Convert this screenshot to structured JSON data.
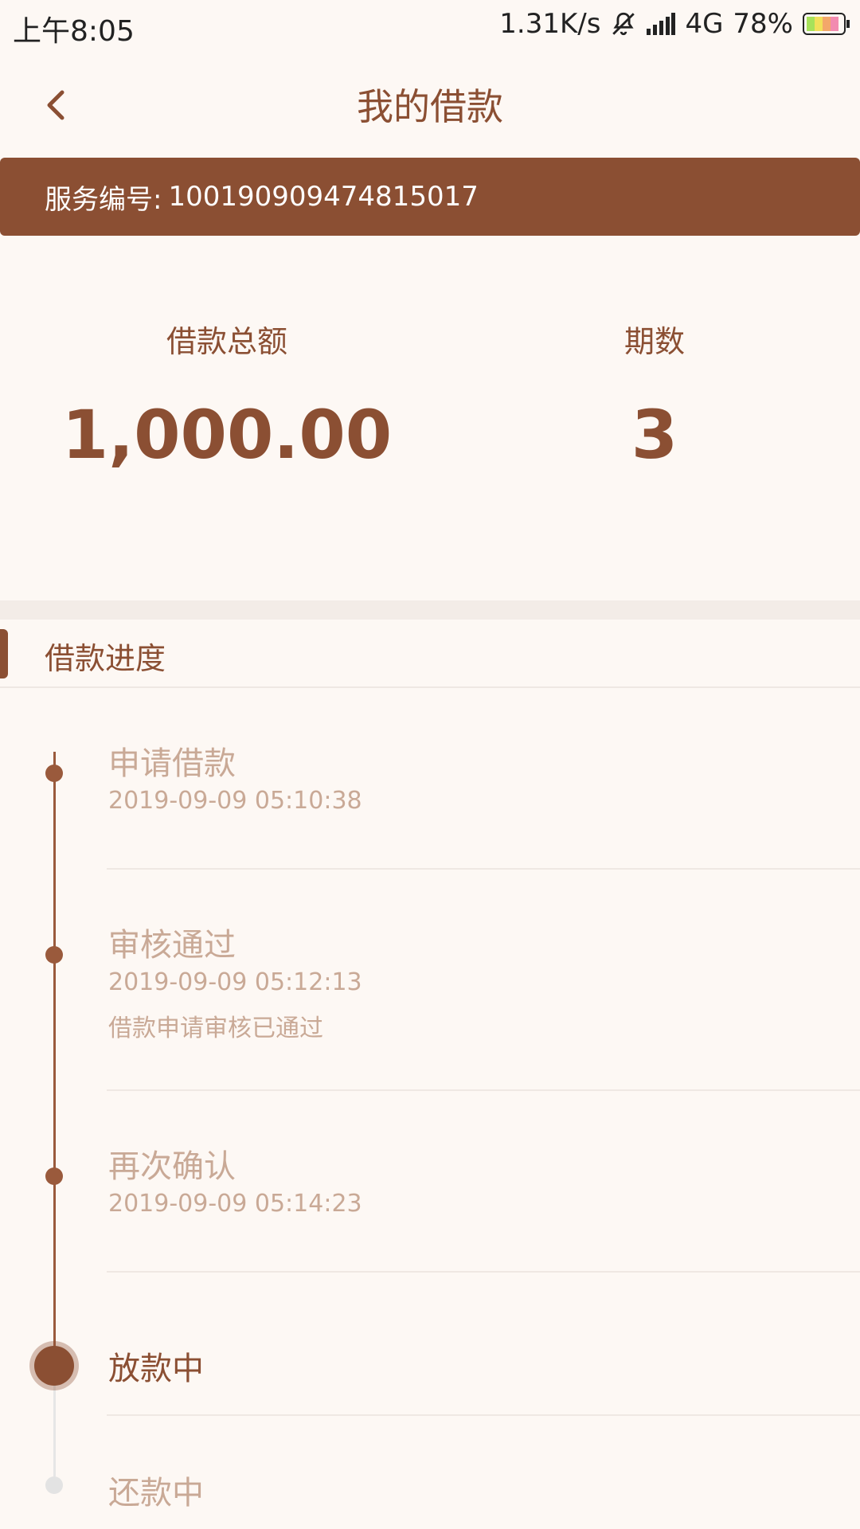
{
  "status_bar": {
    "time": "上午8:05",
    "network_speed": "1.31K/s",
    "network_type": "4G",
    "battery": "78%",
    "icons": [
      "bell-off-icon",
      "signal-icon",
      "battery-icon"
    ]
  },
  "header": {
    "title": "我的借款",
    "back_icon": "chevron-left-icon"
  },
  "service": {
    "label": "服务编号:",
    "number": "100190909474815017"
  },
  "summary": {
    "amount_label": "借款总额",
    "amount_value": "1,000.00",
    "periods_label": "期数",
    "periods_value": "3"
  },
  "progress": {
    "section_title": "借款进度",
    "steps": [
      {
        "title": "申请借款",
        "time": "2019-09-09 05:10:38",
        "note": ""
      },
      {
        "title": "审核通过",
        "time": "2019-09-09 05:12:13",
        "note": "借款申请审核已通过"
      },
      {
        "title": "再次确认",
        "time": "2019-09-09 05:14:23",
        "note": ""
      },
      {
        "title": "放款中",
        "time": "",
        "note": ""
      },
      {
        "title": "还款中",
        "time": "",
        "note": ""
      }
    ]
  },
  "colors": {
    "primary": "#8b4f33",
    "background": "#fdf8f4",
    "muted_text": "#c9a996",
    "pending_dot": "#e3e3e3"
  }
}
